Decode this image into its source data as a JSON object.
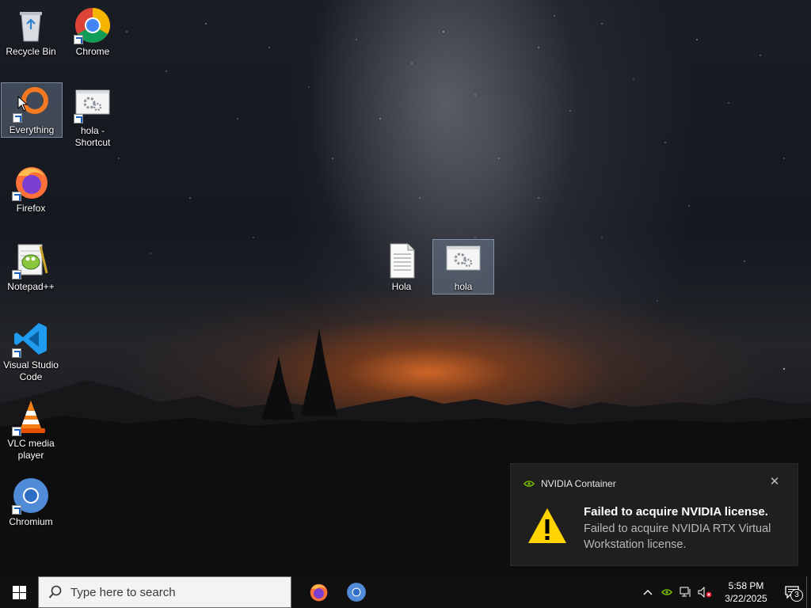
{
  "desktop": {
    "icons": [
      {
        "label": "Recycle Bin"
      },
      {
        "label": "Chrome"
      },
      {
        "label": "Everything"
      },
      {
        "label": "hola -\nShortcut"
      },
      {
        "label": "Firefox"
      },
      {
        "label": "Notepad++"
      },
      {
        "label": "Visual Studio\nCode"
      },
      {
        "label": "VLC media\nplayer"
      },
      {
        "label": "Chromium"
      },
      {
        "label": "Hola"
      },
      {
        "label": "hola"
      }
    ]
  },
  "notification": {
    "app_name": "NVIDIA Container",
    "title": "Failed to acquire NVIDIA license.",
    "body": "Failed to acquire NVIDIA RTX Virtual Workstation license.",
    "close_glyph": "✕",
    "accent_color": "#76b900"
  },
  "taskbar": {
    "search_placeholder": "Type here to search",
    "pinned": [
      "firefox-icon",
      "chromium-icon"
    ],
    "tray": {
      "time": "5:58 PM",
      "date": "3/22/2025",
      "notification_count": "3"
    }
  }
}
